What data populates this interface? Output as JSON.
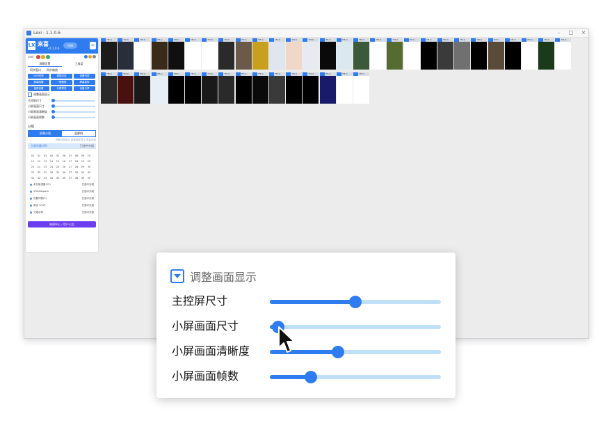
{
  "window": {
    "title": "Lexi - 1.1.0.6",
    "controls": [
      "–",
      "□",
      "×"
    ]
  },
  "sidebar": {
    "brand": "来喜",
    "version": "v1.1.0.6",
    "pill": "在线",
    "collapse": "<",
    "user": "user",
    "tabs": [
      "屏幕设置",
      "工具类"
    ],
    "subtabs": [
      "同步窗口",
      "同步缩放"
    ],
    "buttons": [
      "WIFI切换",
      "调整应用",
      "设备列表",
      "屏幕唤醒",
      "一键截屏",
      "屏幕旋转",
      "锁屏设置",
      "分屏预览",
      "设备分享"
    ],
    "adjust_label": "调整画面显示",
    "mini_sliders": [
      "主控屏尺寸",
      "小屏画面尺寸",
      "小屏画面清晰度",
      "小屏画面帧数"
    ],
    "group_title": "分组",
    "seg": [
      "屏幕分组",
      "全部机"
    ],
    "seg_sub": "设置分组展示  设置投屏显示  屏幕分组",
    "group_row": {
      "name": "主屏设备(49)",
      "right": "已选中分组"
    },
    "numbers": [
      "01",
      "02",
      "03",
      "04",
      "05",
      "06",
      "07",
      "08",
      "09",
      "10",
      "11",
      "12",
      "13",
      "14",
      "15",
      "16",
      "17",
      "18",
      "19",
      "20",
      "21",
      "22",
      "23",
      "24",
      "25",
      "26",
      "27",
      "28",
      "29",
      "30",
      "31",
      "32",
      "33",
      "34",
      "35",
      "36",
      "37",
      "38",
      "39",
      "40",
      "41",
      "42",
      "43",
      "44",
      "45",
      "46",
      "47",
      "48",
      "49",
      "50"
    ],
    "list": [
      {
        "name": "未分组设备(15)",
        "right": "已选中分组"
      },
      {
        "name": "VPadlistpack",
        "right": "已选中分组"
      },
      {
        "name": "设备列表(5)",
        "right": "已选中分组"
      },
      {
        "name": "测试 1(12)",
        "right": "已选中分组"
      },
      {
        "name": "分组示例",
        "right": "已选中分组"
      }
    ],
    "bottom_button": "每周中心 / 用户公告"
  },
  "tiles": {
    "label": "YM-G",
    "row1_screens": [
      "#1b1b1b",
      "#2a2d3a",
      "#ffffff",
      "#3a2a1a",
      "#101010",
      "#ffffff",
      "#ffffff",
      "#2a2a2a",
      "#6b5a4a",
      "#c8a020",
      "#dfe6ef",
      "#f0d8c8",
      "#e8eaf2",
      "#0a0a0a",
      "#dce8f0",
      "#3b5a3a",
      "#ffffff",
      "#556b2f",
      "#ffffff",
      "#000000",
      "#3a3a3a",
      "#707070",
      "#000000",
      "#5a4a3a",
      "#000000",
      "#ffffff",
      "#1a3a1a",
      "#ffffff"
    ],
    "row2_screens": [
      "#2a2a2a",
      "#4a1010",
      "#1a1a1a",
      "#e8eef6",
      "#000000",
      "#000000",
      "#1a1a1a",
      "#2a2a2a",
      "#000000",
      "#0a0a0a",
      "#3a3a3a",
      "#000000",
      "#000000",
      "#1a1a6a",
      "#ffffff",
      "#ffffff"
    ]
  },
  "popup": {
    "title": "调整画面显示",
    "sliders": [
      {
        "label": "主控屏尺寸",
        "value": 0.5
      },
      {
        "label": "小屏画面尺寸",
        "value": 0.05
      },
      {
        "label": "小屏画面清晰度",
        "value": 0.4
      },
      {
        "label": "小屏画面帧数",
        "value": 0.24
      }
    ]
  },
  "colors": {
    "accent": "#2f7cf0",
    "track": "#bfe0f7",
    "purple": "#6d3df0"
  }
}
